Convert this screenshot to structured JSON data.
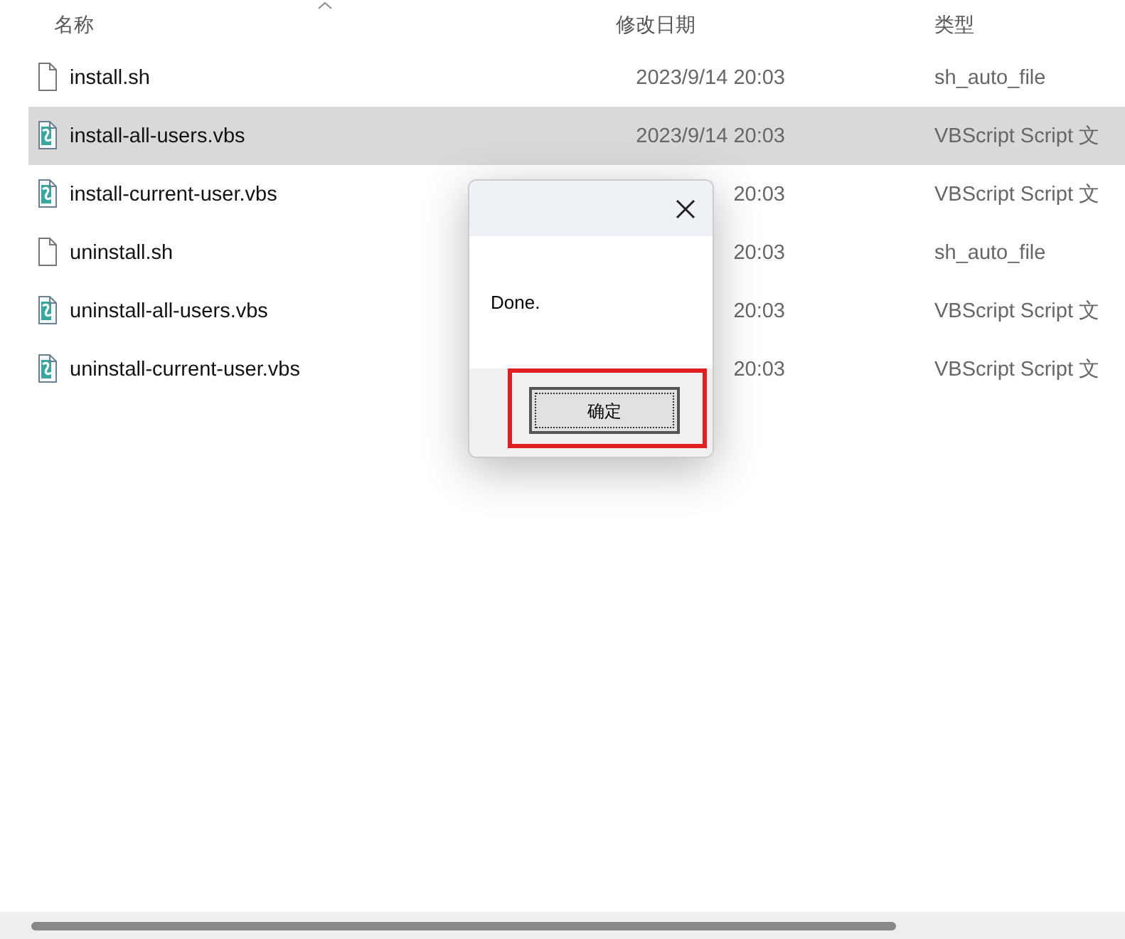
{
  "columns": [
    {
      "label": "名称",
      "sorted": true
    },
    {
      "label": "修改日期",
      "sorted": false
    },
    {
      "label": "类型",
      "sorted": false
    }
  ],
  "files": [
    {
      "kind": "text",
      "name": "install.sh",
      "date": "2023/9/14 20:03",
      "type": "sh_auto_file",
      "selected": false
    },
    {
      "kind": "script",
      "name": "install-all-users.vbs",
      "date": "2023/9/14 20:03",
      "type": "VBScript Script 文",
      "selected": true
    },
    {
      "kind": "script",
      "name": "install-current-user.vbs",
      "date": "20:03",
      "type": "VBScript Script 文",
      "selected": false
    },
    {
      "kind": "text",
      "name": "uninstall.sh",
      "date": "20:03",
      "type": "sh_auto_file",
      "selected": false
    },
    {
      "kind": "script",
      "name": "uninstall-all-users.vbs",
      "date": "20:03",
      "type": "VBScript Script 文",
      "selected": false
    },
    {
      "kind": "script",
      "name": "uninstall-current-user.vbs",
      "date": "20:03",
      "type": "VBScript Script 文",
      "selected": false
    }
  ],
  "dialog": {
    "message": "Done.",
    "button": "确定",
    "button_highlighted": true
  }
}
